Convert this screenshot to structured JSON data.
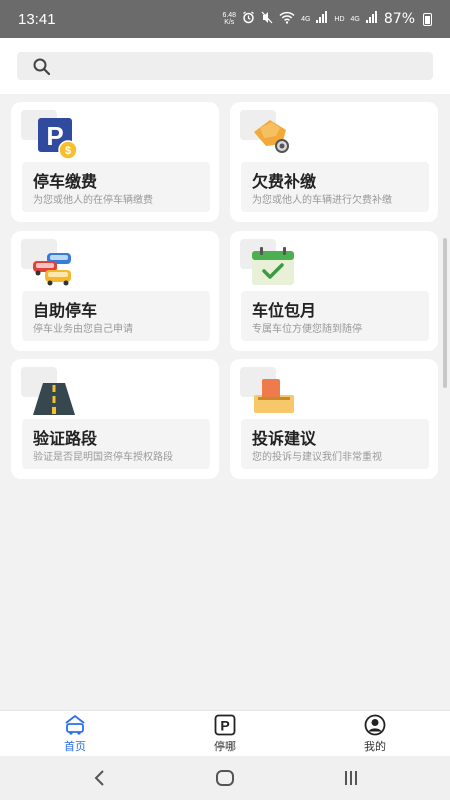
{
  "status_bar": {
    "time": "13:41",
    "net_speed_value": "6.48",
    "net_speed_unit": "K/s",
    "network_label_1": "4G",
    "hd_label": "HD",
    "network_label_2": "4G",
    "battery": "87%"
  },
  "search": {
    "placeholder": ""
  },
  "services": [
    {
      "title": "停车缴费",
      "desc": "为您或他人的在停车辆缴费",
      "icon": "parking-payment-icon"
    },
    {
      "title": "欠费补缴",
      "desc": "为您或他人的车辆进行欠费补缴",
      "icon": "hand-coin-icon"
    },
    {
      "title": "自助停车",
      "desc": "停车业务由您自己申请",
      "icon": "cars-icon"
    },
    {
      "title": "车位包月",
      "desc": "专属车位方便您随到随停",
      "icon": "calendar-check-icon"
    },
    {
      "title": "验证路段",
      "desc": "验证是否昆明国资停车授权路段",
      "icon": "road-icon"
    },
    {
      "title": "投诉建议",
      "desc": "您的投诉与建议我们非常重视",
      "icon": "suggestion-box-icon"
    }
  ],
  "tabbar": {
    "items": [
      {
        "label": "首页",
        "icon": "home-car-icon",
        "active": true
      },
      {
        "label": "停哪",
        "icon": "parking-p-icon",
        "active": false
      },
      {
        "label": "我的",
        "icon": "user-icon",
        "active": false
      }
    ]
  },
  "colors": {
    "accent": "#2a6ef0",
    "background": "#f2f2f2",
    "status_bar": "#6b6b6b"
  }
}
